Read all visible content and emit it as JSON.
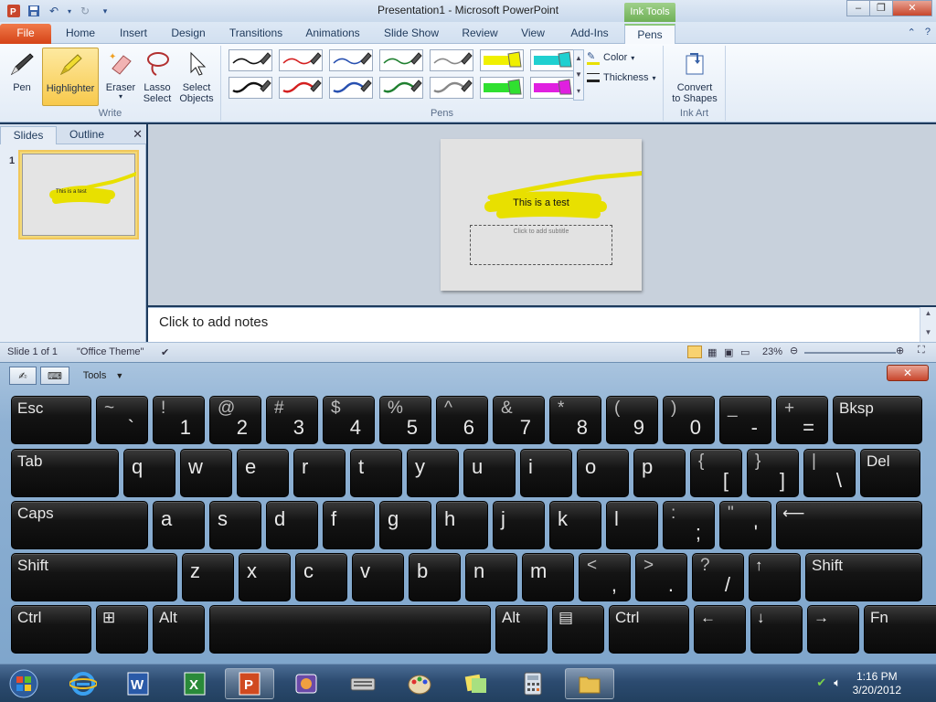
{
  "window": {
    "title": "Presentation1 - Microsoft PowerPoint",
    "context_tab": "Ink Tools",
    "minimize": "–",
    "restore": "❐",
    "close": "✕"
  },
  "ribbon": {
    "tabs": [
      "File",
      "Home",
      "Insert",
      "Design",
      "Transitions",
      "Animations",
      "Slide Show",
      "Review",
      "View",
      "Add-Ins",
      "Pens"
    ],
    "write_group": {
      "label": "Write",
      "pen": "Pen",
      "highlighter": "Highlighter",
      "eraser": "Eraser",
      "lasso": "Lasso Select",
      "lasso_l1": "Lasso",
      "lasso_l2": "Select",
      "select_l1": "Select",
      "select_l2": "Objects"
    },
    "pens_group": {
      "label": "Pens",
      "color": "Color",
      "thickness": "Thickness"
    },
    "inkart_group": {
      "label": "Ink Art",
      "convert_l1": "Convert",
      "convert_l2": "to Shapes"
    },
    "pen_colors_row1": [
      "#111111",
      "#d42020",
      "#2850b0",
      "#208030",
      "#888888",
      "#f0f000",
      "#20d0d0"
    ],
    "pen_colors_row2": [
      "#111111",
      "#d42020",
      "#2850b0",
      "#208030",
      "#888888",
      "#30e030",
      "#e020e0"
    ]
  },
  "slides_panel": {
    "tab_slides": "Slides",
    "tab_outline": "Outline",
    "close": "✕",
    "slide_number": "1",
    "thumb_text": "This is a test"
  },
  "slide": {
    "title": "This is a test",
    "subtitle_placeholder": "Click to add subtitle",
    "highlight_color": "#e8e000"
  },
  "notes": {
    "placeholder": "Click to add notes"
  },
  "statusbar": {
    "slide_info": "Slide 1 of 1",
    "theme": "\"Office Theme\"",
    "zoom": "23%"
  },
  "osk": {
    "tools": "Tools",
    "close": "✕",
    "row1": [
      {
        "label": "Esc",
        "type": "label"
      },
      {
        "top": "~",
        "main": "`"
      },
      {
        "top": "!",
        "main": "1"
      },
      {
        "top": "@",
        "main": "2"
      },
      {
        "top": "#",
        "main": "3"
      },
      {
        "top": "$",
        "main": "4"
      },
      {
        "top": "%",
        "main": "5"
      },
      {
        "top": "^",
        "main": "6"
      },
      {
        "top": "&",
        "main": "7"
      },
      {
        "top": "*",
        "main": "8"
      },
      {
        "top": "(",
        "main": "9"
      },
      {
        "top": ")",
        "main": "0"
      },
      {
        "top": "_",
        "main": "-"
      },
      {
        "top": "+",
        "main": "="
      },
      {
        "label": "Bksp",
        "type": "label"
      }
    ],
    "row2": [
      {
        "label": "Tab",
        "type": "label"
      },
      {
        "ch": "q"
      },
      {
        "ch": "w"
      },
      {
        "ch": "e"
      },
      {
        "ch": "r"
      },
      {
        "ch": "t"
      },
      {
        "ch": "y"
      },
      {
        "ch": "u"
      },
      {
        "ch": "i"
      },
      {
        "ch": "o"
      },
      {
        "ch": "p"
      },
      {
        "top": "{",
        "main": "["
      },
      {
        "top": "}",
        "main": "]"
      },
      {
        "top": "|",
        "main": "\\"
      },
      {
        "label": "Del",
        "type": "label"
      }
    ],
    "row3": [
      {
        "label": "Caps",
        "type": "label"
      },
      {
        "ch": "a"
      },
      {
        "ch": "s"
      },
      {
        "ch": "d"
      },
      {
        "ch": "f"
      },
      {
        "ch": "g"
      },
      {
        "ch": "h"
      },
      {
        "ch": "j"
      },
      {
        "ch": "k"
      },
      {
        "ch": "l"
      },
      {
        "top": ":",
        "main": ";"
      },
      {
        "top": "\"",
        "main": "'"
      },
      {
        "label": "⟵",
        "type": "label"
      }
    ],
    "row4": [
      {
        "label": "Shift",
        "type": "label"
      },
      {
        "ch": "z"
      },
      {
        "ch": "x"
      },
      {
        "ch": "c"
      },
      {
        "ch": "v"
      },
      {
        "ch": "b"
      },
      {
        "ch": "n"
      },
      {
        "ch": "m"
      },
      {
        "top": "<",
        "main": ","
      },
      {
        "top": ">",
        "main": "."
      },
      {
        "top": "?",
        "main": "/"
      },
      {
        "label": "↑",
        "type": "label"
      },
      {
        "label": "Shift",
        "type": "label"
      }
    ],
    "row5": [
      {
        "label": "Ctrl",
        "type": "label"
      },
      {
        "label": "⊞",
        "type": "label"
      },
      {
        "label": "Alt",
        "type": "label"
      },
      {
        "label": "",
        "type": "label"
      },
      {
        "label": "Alt",
        "type": "label"
      },
      {
        "label": "▤",
        "type": "label"
      },
      {
        "label": "Ctrl",
        "type": "label"
      },
      {
        "label": "←",
        "type": "label"
      },
      {
        "label": "↓",
        "type": "label"
      },
      {
        "label": "→",
        "type": "label"
      },
      {
        "label": "Fn",
        "type": "label"
      }
    ]
  },
  "taskbar": {
    "time": "1:16 PM",
    "date": "3/20/2012",
    "icons": [
      "start-orb-icon",
      "internet-explorer-icon",
      "word-icon",
      "excel-icon",
      "powerpoint-icon",
      "photo-app-icon",
      "keyboard-icon",
      "paint-icon",
      "sticky-notes-icon",
      "calculator-icon",
      "folder-icon"
    ]
  }
}
